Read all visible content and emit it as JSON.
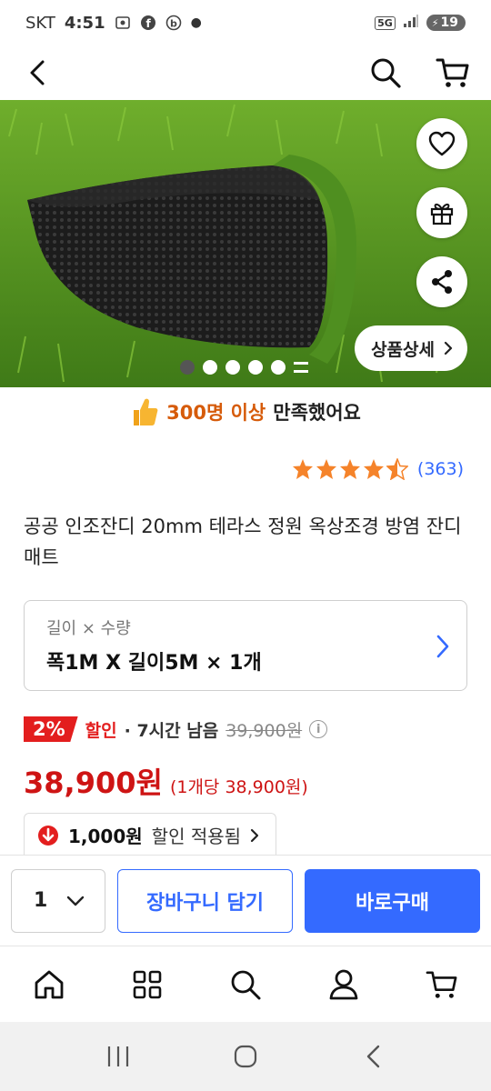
{
  "status_bar": {
    "carrier": "SKT",
    "time": "4:51",
    "network": "5G",
    "battery": "19"
  },
  "top_nav": {
    "icons": [
      "back-icon",
      "search-icon",
      "cart-icon"
    ]
  },
  "hero": {
    "detail_label": "상품상세",
    "slide_count": 5,
    "active_slide": 1,
    "fab_icons": [
      "heart-icon",
      "gift-icon",
      "share-icon"
    ]
  },
  "satisfaction": {
    "highlight": "300명 이상",
    "text": "만족했어요"
  },
  "rating": {
    "stars": 4.5,
    "count": "(363)"
  },
  "product": {
    "title": "공공 인조잔디 20mm 테라스 정원 옥상조경 방염 잔디매트"
  },
  "option": {
    "label": "길이 × 수량",
    "value": "폭1M X 길이5M × 1개"
  },
  "discount": {
    "percent": "2%",
    "label": "할인",
    "time_left": "· 7시간 남음",
    "original_price": "39,900원"
  },
  "price": {
    "sale": "38,900원",
    "unit": "(1개당 38,900원)"
  },
  "coupon": {
    "amount": "1,000원",
    "text": "할인 적용됨"
  },
  "buy_bar": {
    "quantity": "1",
    "cart_label": "장바구니 담기",
    "buy_label": "바로구매"
  },
  "colors": {
    "accent": "#346aff",
    "price_red": "#ce1414",
    "badge_red": "#e31e1e",
    "highlight_orange": "#d65b0a",
    "star": "#f5832a"
  },
  "tab_bar": {
    "icons": [
      "home-icon",
      "category-icon",
      "search-icon",
      "my-page-icon",
      "cart-icon"
    ]
  },
  "system_nav": {
    "icons": [
      "recent-apps-icon",
      "home-button-icon",
      "back-button-icon"
    ]
  }
}
